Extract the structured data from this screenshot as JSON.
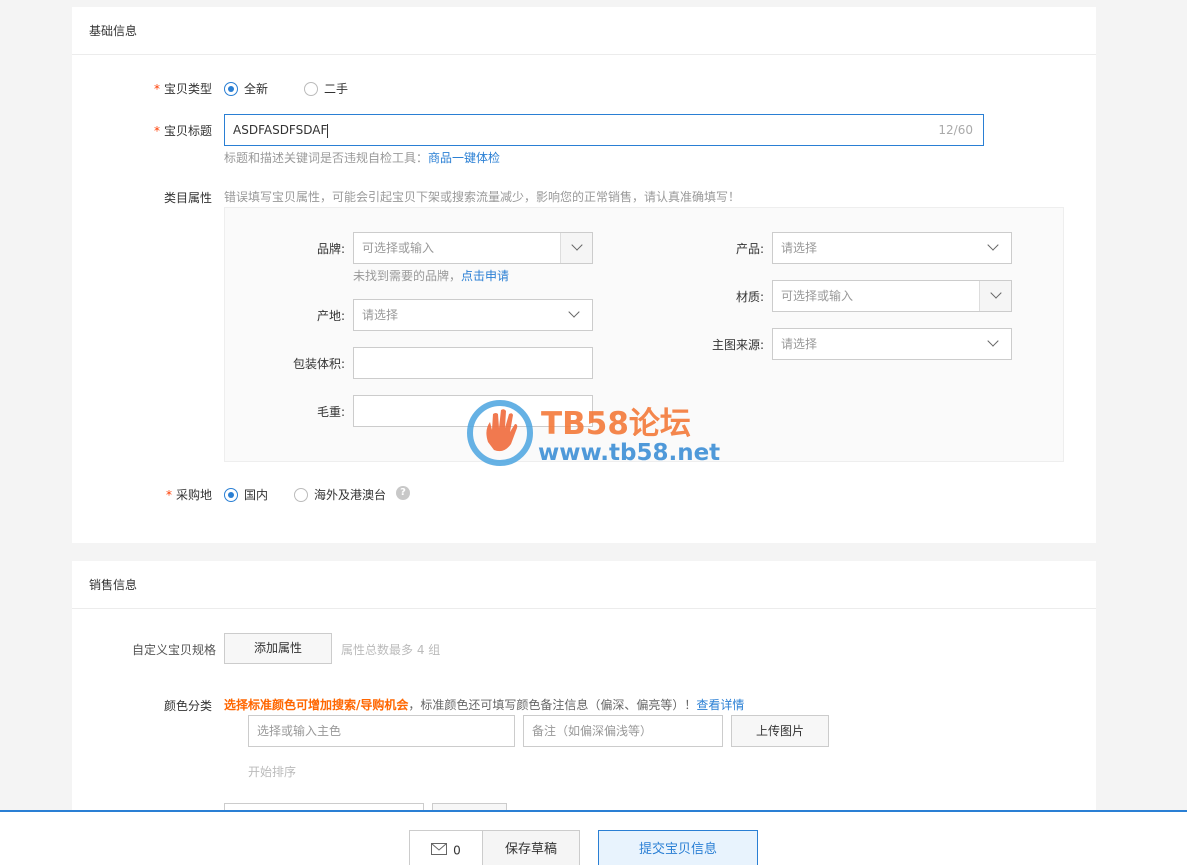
{
  "basic": {
    "section_title": "基础信息",
    "item_type": {
      "required_mark": "*",
      "label": "宝贝类型",
      "options": [
        "全新",
        "二手"
      ],
      "selected": 0
    },
    "title_field": {
      "required_mark": "*",
      "label": "宝贝标题",
      "value": "ASDFASDFSDAF",
      "counter": "12/60",
      "hint_prefix": "标题和描述关键词是否违规自检工具：",
      "hint_link": "商品一键体检"
    },
    "category": {
      "label": "类目属性",
      "warning": "错误填写宝贝属性，可能会引起宝贝下架或搜索流量减少，影响您的正常销售，请认真准确填写！",
      "brand": {
        "label": "品牌:",
        "placeholder": "可选择或输入",
        "hint_prefix": "未找到需要的品牌，",
        "hint_link": "点击申请"
      },
      "origin": {
        "label": "产地:",
        "placeholder": "请选择"
      },
      "package_volume": {
        "label": "包装体积:",
        "value": ""
      },
      "gross_weight": {
        "label": "毛重:",
        "value": ""
      },
      "product": {
        "label": "产品:",
        "placeholder": "请选择"
      },
      "material": {
        "label": "材质:",
        "placeholder": "可选择或输入"
      },
      "main_image_source": {
        "label": "主图来源:",
        "placeholder": "请选择"
      }
    },
    "purchase_location": {
      "required_mark": "*",
      "label": "采购地",
      "options": [
        "国内",
        "海外及港澳台"
      ],
      "selected": 0,
      "help_icon": "question-circle-icon"
    }
  },
  "sales": {
    "section_title": "销售信息",
    "custom_spec": {
      "label": "自定义宝贝规格",
      "button": "添加属性",
      "hint": "属性总数最多 4 组"
    },
    "color": {
      "label": "颜色分类",
      "promo_text": "选择标准颜色可增加搜索/导购机会",
      "promo_rest": "，标准颜色还可填写颜色备注信息（偏深、偏亮等）！",
      "detail_link": "查看详情",
      "main_color_placeholder": "选择或输入主色",
      "note_placeholder": "备注（如偏深偏浅等）",
      "upload_button": "上传图片",
      "sort_text": "开始排序"
    }
  },
  "watermark": {
    "title": "TB58论坛",
    "url": "www.tb58.net"
  },
  "footer": {
    "message_icon": "envelope-icon",
    "message_count": "0",
    "save_draft": "保存草稿",
    "submit": "提交宝贝信息"
  },
  "colors": {
    "accent": "#2a7fd4",
    "required": "#ff3d00",
    "promo": "#ff6600"
  }
}
